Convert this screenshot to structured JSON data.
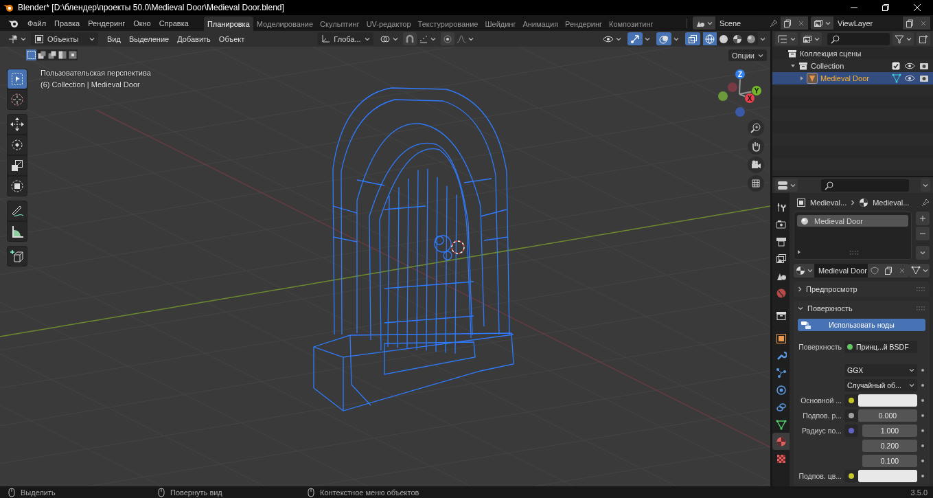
{
  "window": {
    "title": "Blender* [D:\\блендер\\проекты 50.0\\Medieval Door\\Medieval Door.blend]"
  },
  "menu": [
    "Файл",
    "Правка",
    "Рендеринг",
    "Окно",
    "Справка"
  ],
  "workspaces": [
    {
      "label": "Планировка",
      "selected": true
    },
    {
      "label": "Моделирование",
      "selected": false
    },
    {
      "label": "Скульптинг",
      "selected": false
    },
    {
      "label": "UV-редактор",
      "selected": false
    },
    {
      "label": "Текстурирование",
      "selected": false
    },
    {
      "label": "Шейдинг",
      "selected": false
    },
    {
      "label": "Анимация",
      "selected": false
    },
    {
      "label": "Рендеринг",
      "selected": false
    },
    {
      "label": "Композитинг",
      "selected": false
    }
  ],
  "scene": {
    "name": "Scene"
  },
  "view_layer": {
    "name": "ViewLayer"
  },
  "viewport": {
    "mode": "Объекты",
    "menus": [
      "Вид",
      "Выделение",
      "Добавить",
      "Объект"
    ],
    "orientation": "Глоба...",
    "toggles": [
      {
        "kind": "gizmo",
        "on": true
      },
      {
        "kind": "overlay",
        "on": true
      },
      {
        "kind": "xray",
        "on": true
      }
    ],
    "shading": [
      {
        "kind": "wireframe",
        "selected": true
      },
      {
        "kind": "solid",
        "selected": false
      },
      {
        "kind": "material",
        "selected": false
      },
      {
        "kind": "rendered",
        "selected": false
      }
    ],
    "select_modes": [
      {
        "selected": true
      },
      {
        "selected": false
      },
      {
        "selected": false
      },
      {
        "selected": false
      },
      {
        "selected": false
      }
    ],
    "options": "Опции",
    "view_name": "Пользовательская перспектива",
    "collection_info": "(6) Collection | Medieval Door",
    "tool_groups": [
      {
        "tools": [
          {
            "kind": "select",
            "selected": true
          },
          {
            "kind": "cursor",
            "selected": false
          }
        ]
      },
      {
        "tools": [
          {
            "kind": "move",
            "selected": false
          },
          {
            "kind": "rotate",
            "selected": false
          },
          {
            "kind": "scale",
            "selected": false
          },
          {
            "kind": "transform",
            "selected": false
          }
        ]
      },
      {
        "tools": [
          {
            "kind": "annotate",
            "selected": false
          },
          {
            "kind": "measure",
            "selected": false
          }
        ]
      },
      {
        "tools": [
          {
            "kind": "add_cube",
            "selected": false
          }
        ]
      }
    ],
    "gizmo": {
      "x": "X",
      "y": "Y",
      "z": "Z"
    }
  },
  "outliner": {
    "items": [
      {
        "label": "Коллекция сцены",
        "kind": "scene_collection",
        "selected": false,
        "children": [
          {
            "label": "Collection",
            "kind": "collection",
            "expanded": true,
            "checked": true,
            "selected": false,
            "children": [
              {
                "label": "Medieval Door",
                "kind": "object",
                "expanded": false,
                "selected": true
              }
            ]
          }
        ]
      }
    ]
  },
  "properties": {
    "tabs": [
      {
        "kind": "tool",
        "selected": false
      },
      {
        "kind": "render",
        "selected": false
      },
      {
        "kind": "output",
        "selected": false
      },
      {
        "kind": "view_layer",
        "selected": false
      },
      {
        "kind": "scene",
        "selected": false
      },
      {
        "kind": "world",
        "selected": false
      },
      {
        "kind": "collection",
        "selected": false
      },
      {
        "kind": "object",
        "selected": false
      },
      {
        "kind": "modifiers",
        "selected": false
      },
      {
        "kind": "particles",
        "selected": false
      },
      {
        "kind": "physics",
        "selected": false
      },
      {
        "kind": "constraints",
        "selected": false
      },
      {
        "kind": "data",
        "selected": false
      },
      {
        "kind": "material",
        "selected": true
      },
      {
        "kind": "texture",
        "selected": false
      }
    ],
    "breadcrumb": [
      "Medieval...",
      "Medieval..."
    ],
    "slots": [
      {
        "label": "Medieval Door",
        "selected": true
      }
    ],
    "material": "Medieval Door",
    "panels": [
      {
        "label": "Предпросмотр",
        "expanded": false
      },
      {
        "label": "Поверхность",
        "expanded": true
      }
    ],
    "use_nodes": "Использовать ноды",
    "rows": [
      {
        "kind": "link",
        "label": "Поверхность",
        "value": "Принц...й BSDF",
        "color": "#63c763"
      },
      {
        "kind": "dropdown",
        "value": "GGX"
      },
      {
        "kind": "dropdown",
        "value": "Случайный об..."
      },
      {
        "kind": "color",
        "label": "Основной ...",
        "color": "#c7c729"
      },
      {
        "kind": "number",
        "label": "Подпов. р...",
        "value": "0.000",
        "color": "#a1a1a1"
      },
      {
        "kind": "vector",
        "label": "Радиус по...",
        "values": [
          "1.000",
          "0.200",
          "0.100"
        ],
        "color": "#6363c7"
      },
      {
        "kind": "color",
        "label": "Подпов. цв...",
        "color": "#c7c729"
      }
    ]
  },
  "status_bar": {
    "hints": [
      "Выделить",
      "Повернуть вид",
      "Контекстное меню объектов"
    ],
    "version": "3.5.0"
  }
}
